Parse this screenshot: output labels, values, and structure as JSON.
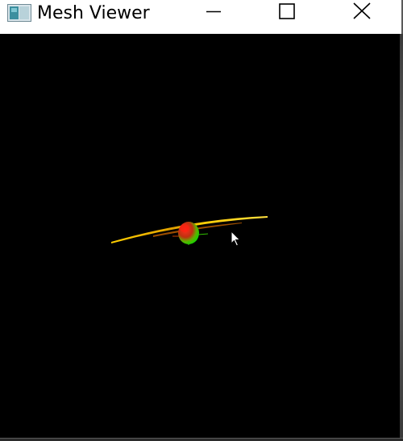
{
  "window": {
    "title": "Mesh Viewer",
    "icons": {
      "app": "mesh-viewer-app-icon",
      "minimize": "minimize-icon",
      "maximize": "maximize-icon",
      "close": "close-icon"
    }
  },
  "viewport": {
    "background": "#000000",
    "object_colors": [
      "#ffd000",
      "#00c000",
      "#c04000",
      "#ff0000"
    ]
  }
}
